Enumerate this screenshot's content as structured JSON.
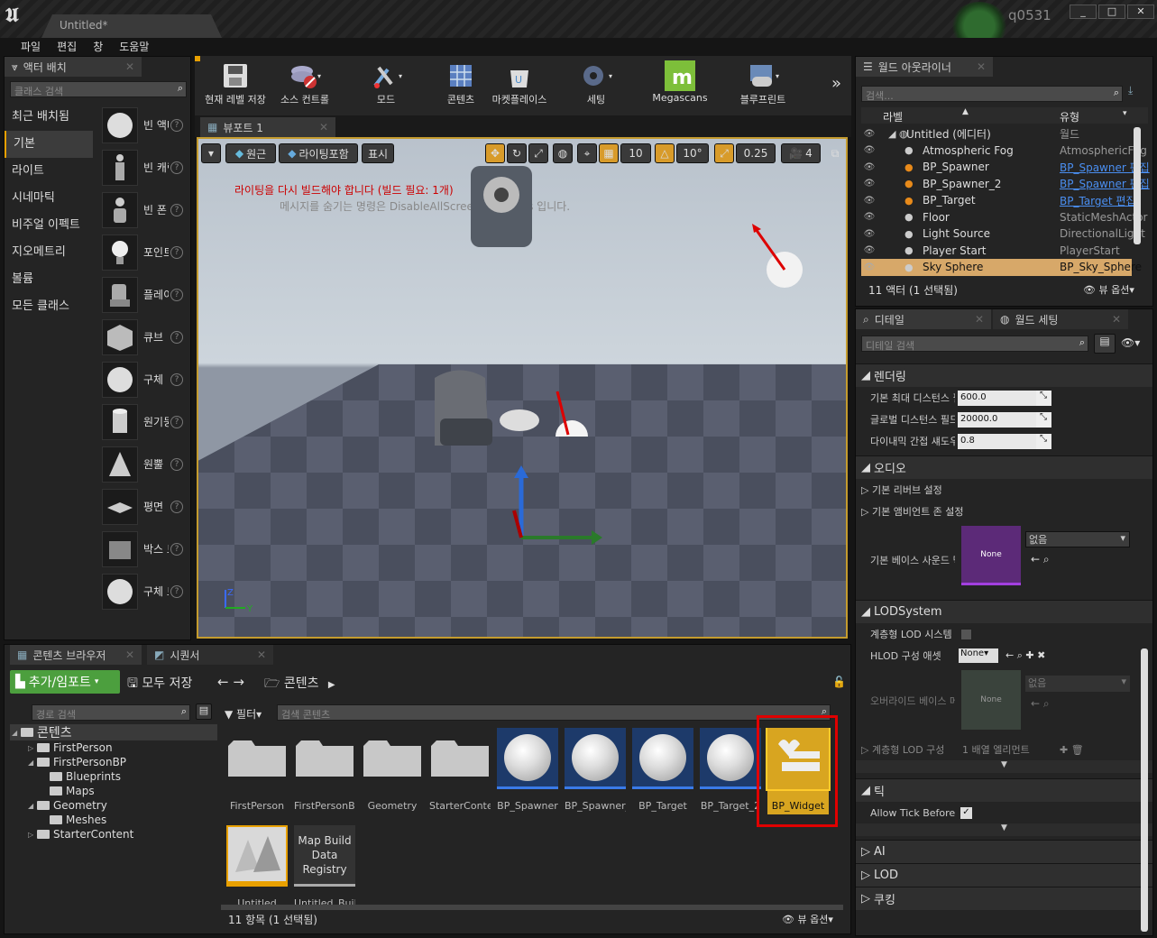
{
  "window": {
    "doc_tab": "Untitled*",
    "username": "q0531",
    "controls": [
      "_",
      "□",
      "✕"
    ]
  },
  "menu": [
    "파일",
    "편집",
    "창",
    "도움말"
  ],
  "place_actor": {
    "tab": "액터 배치",
    "search_placeholder": "클래스 검색",
    "categories": [
      "최근 배치됨",
      "기본",
      "라이트",
      "시네마틱",
      "비주얼 이펙트",
      "지오메트리",
      "볼륨",
      "모든 클래스"
    ],
    "selected_category": 1,
    "items": [
      "빈 액터",
      "빈 캐릭터",
      "빈 폰",
      "포인트 라이트",
      "플레이어 스타트",
      "큐브",
      "구체",
      "원기둥",
      "원뿔",
      "평면",
      "박스 트리거",
      "구체 트리거"
    ]
  },
  "toolbar": {
    "buttons": [
      "현재 레벨 저장",
      "소스 컨트롤",
      "모드",
      "콘텐츠",
      "마켓플레이스",
      "세팅",
      "Megascans",
      "블루프린트"
    ]
  },
  "viewport": {
    "tab": "뷰포트 1",
    "perspective": "원근",
    "lit": "라이팅포함",
    "show": "표시",
    "grid": "10",
    "rot": "10°",
    "scale": "0.25",
    "cam_speed": "4",
    "warning": "라이팅을 다시 빌드해야 합니다 (빌드 필요: 1개)",
    "hint": "메시지를 숨기는 명령은 DisableAllScreenMessages 입니다."
  },
  "outliner": {
    "tab": "월드 아웃라이너",
    "search_placeholder": "검색...",
    "col_label": "라벨",
    "col_type": "유형",
    "rows": [
      {
        "name": "Untitled (에디터)",
        "type": "월드",
        "link": false
      },
      {
        "name": "Atmospheric Fog",
        "type": "AtmosphericFog",
        "link": false
      },
      {
        "name": "BP_Spawner",
        "type": "BP_Spawner 편집",
        "link": true
      },
      {
        "name": "BP_Spawner_2",
        "type": "BP_Spawner 편집",
        "link": true
      },
      {
        "name": "BP_Target",
        "type": "BP_Target 편집",
        "link": true
      },
      {
        "name": "Floor",
        "type": "StaticMeshActor",
        "link": false
      },
      {
        "name": "Light Source",
        "type": "DirectionalLight",
        "link": false
      },
      {
        "name": "Player Start",
        "type": "PlayerStart",
        "link": false
      },
      {
        "name": "Sky Sphere",
        "type": "BP_Sky_Sphere",
        "link": false
      }
    ],
    "selected_row": 8,
    "footer": "11 액터 (1 선택됨)",
    "view_options": "뷰 옵션"
  },
  "details": {
    "tab_details": "디테일",
    "tab_world": "월드 세팅",
    "search_placeholder": "디테일 검색",
    "rendering": "렌더링",
    "props": [
      {
        "label": "기본 최대 디스턴스 필드",
        "value": "600.0"
      },
      {
        "label": "글로벌 디스턴스 필드 뷰",
        "value": "20000.0"
      },
      {
        "label": "다이내믹 간접 섀도우",
        "value": "0.8"
      }
    ],
    "audio": "오디오",
    "reverb": "기본 리버브 설정",
    "ambient": "기본 앰비언트 존 설정",
    "base_sound": "기본 베이스 사운드 믹스",
    "none": "None",
    "none_kr": "없음",
    "lod_system": "LODSystem",
    "hlod_system": "계층형 LOD 시스템 활성화",
    "hlod_asset": "HLOD 구성 애셋",
    "override_base": "오버라이드 베이스 메타",
    "hlod_setup": "계층형 LOD 구성",
    "array_count": "1 배열 엘리먼트",
    "tick": "틱",
    "allow_tick": "Allow Tick Before BeginPlay",
    "ai": "AI",
    "lod": "LOD",
    "cooking": "쿠킹"
  },
  "content_browser": {
    "tab": "콘텐츠 브라우저",
    "tab2": "시퀀서",
    "add_import": "추가/임포트",
    "save_all": "모두 저장",
    "path": "콘텐츠",
    "path_search": "경로 검색",
    "filter": "필터",
    "search_placeholder": "검색 콘텐츠",
    "tree": [
      {
        "name": "콘텐츠",
        "depth": 0
      },
      {
        "name": "FirstPerson",
        "depth": 1
      },
      {
        "name": "FirstPersonBP",
        "depth": 1
      },
      {
        "name": "Blueprints",
        "depth": 2
      },
      {
        "name": "Maps",
        "depth": 2
      },
      {
        "name": "Geometry",
        "depth": 1
      },
      {
        "name": "Meshes",
        "depth": 2
      },
      {
        "name": "StarterContent",
        "depth": 1
      }
    ],
    "assets": [
      {
        "name": "FirstPerson",
        "kind": "folder"
      },
      {
        "name": "FirstPersonBP",
        "kind": "folder"
      },
      {
        "name": "Geometry",
        "kind": "folder"
      },
      {
        "name": "StarterContent",
        "kind": "folder"
      },
      {
        "name": "BP_Spawner",
        "kind": "sphere"
      },
      {
        "name": "BP_Spawner_2",
        "kind": "sphere"
      },
      {
        "name": "BP_Target",
        "kind": "sphere"
      },
      {
        "name": "BP_Target_2",
        "kind": "sphere"
      },
      {
        "name": "BP_Widget",
        "kind": "widget"
      },
      {
        "name": "Untitled",
        "kind": "map"
      },
      {
        "name": "Untitled_BuiltData",
        "kind": "registry",
        "thumb": "Map Build Data Registry"
      }
    ],
    "footer": "11 항목 (1 선택됨)",
    "view_options": "뷰 옵션"
  },
  "colors": {
    "accent": "#e8a000",
    "selected": "#d7a869",
    "add_green": "#4c9f3e",
    "warn": "#cc0000",
    "highlight_box": "#e00000"
  }
}
